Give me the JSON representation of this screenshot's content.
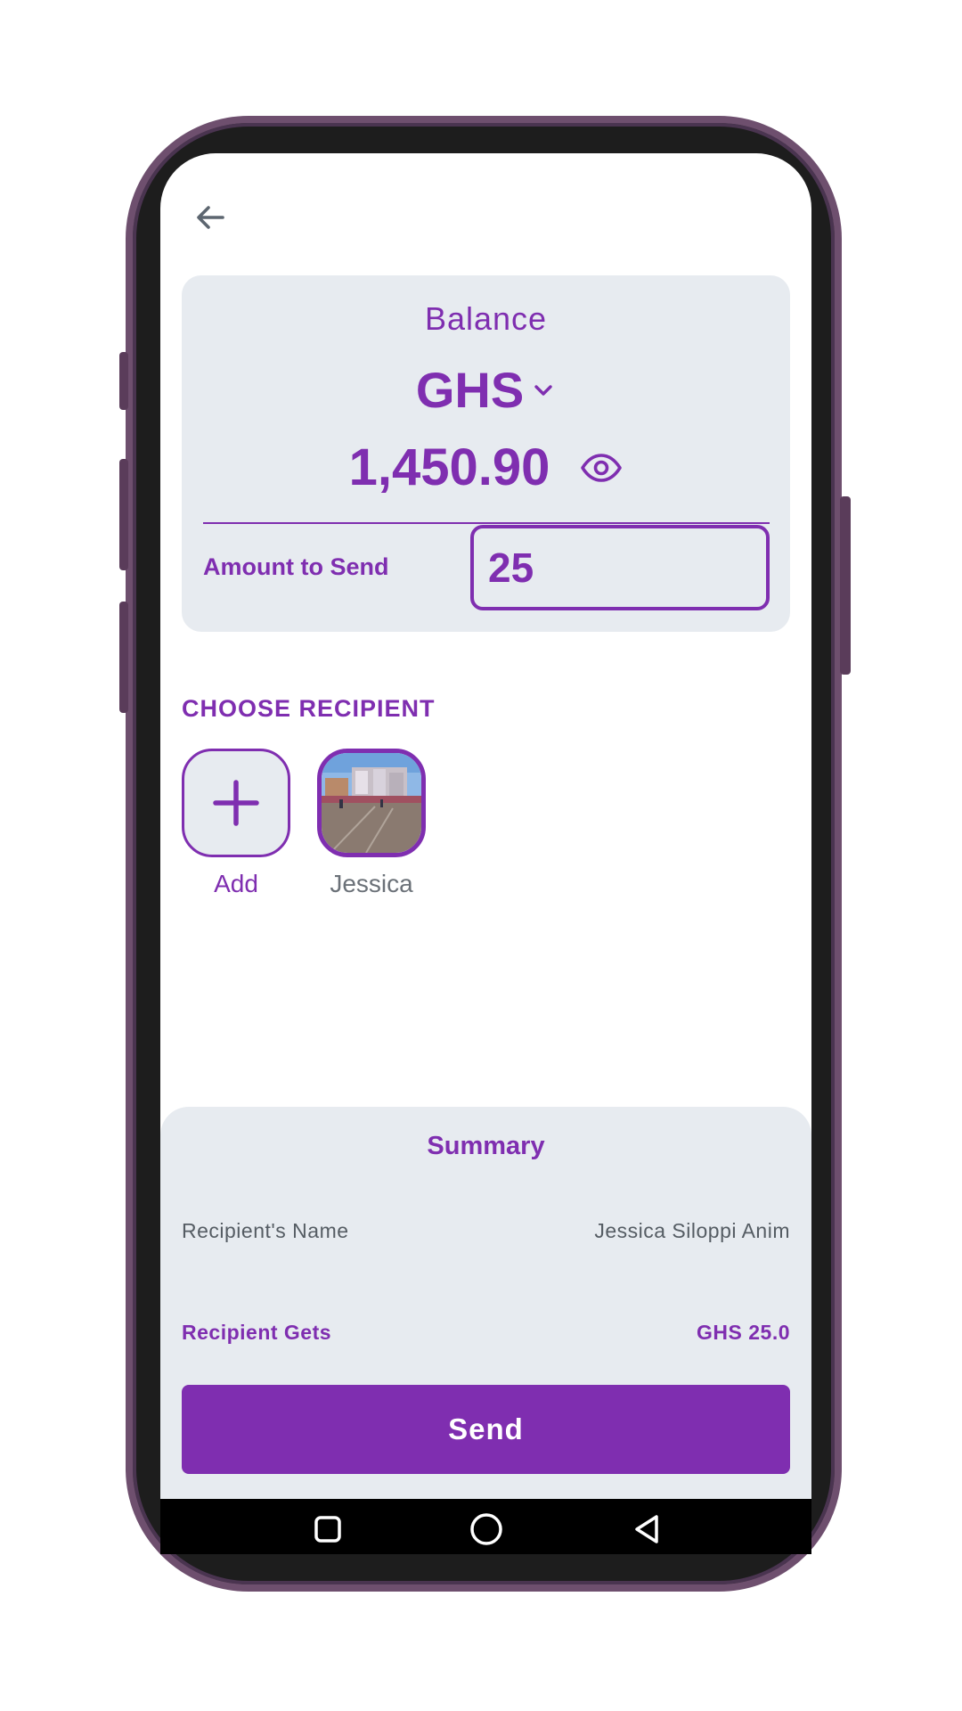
{
  "header": {
    "back_icon": "arrow-left-icon"
  },
  "balance": {
    "label": "Balance",
    "currency": "GHS",
    "amount": "1,450.90",
    "visibility_icon": "eye-icon"
  },
  "send": {
    "amount_label": "Amount to Send",
    "amount_value": "25"
  },
  "recipients": {
    "title": "CHOOSE RECIPIENT",
    "items": [
      {
        "label": "Add",
        "icon": "plus-icon"
      },
      {
        "label": "Jessica",
        "icon": "avatar-photo"
      }
    ]
  },
  "summary": {
    "title": "Summary",
    "name_label": "Recipient's Name",
    "name_value": "Jessica Siloppi Anim",
    "gets_label": "Recipient Gets",
    "gets_value": "GHS 25.0",
    "send_label": "Send"
  },
  "colors": {
    "accent": "#7f2eb0",
    "card": "#e7ebf0",
    "muted_text": "#555c63"
  }
}
